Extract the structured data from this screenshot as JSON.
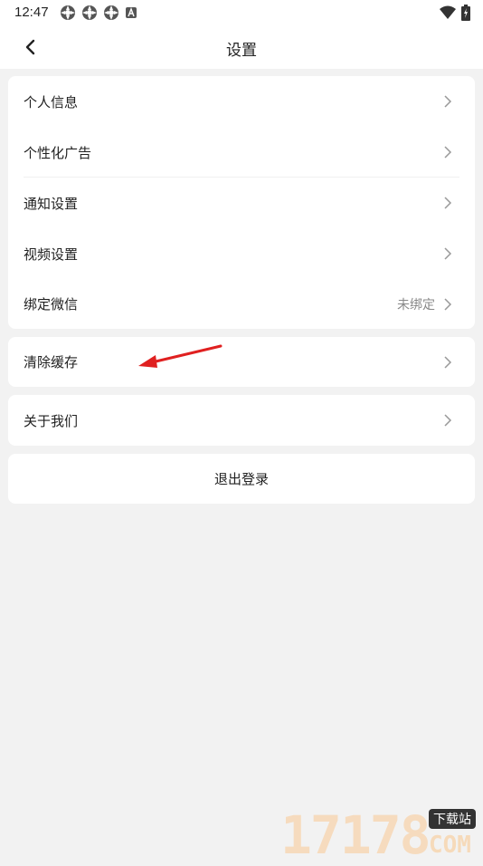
{
  "status_bar": {
    "time": "12:47",
    "notification_icons": [
      "app-icon",
      "app-icon",
      "app-icon",
      "a-box-icon"
    ],
    "right_icons": [
      "wifi-icon",
      "battery-charging-icon"
    ]
  },
  "header": {
    "back_icon": "chevron-left-icon",
    "title": "设置"
  },
  "groups": [
    {
      "items": [
        {
          "label": "个人信息",
          "value": ""
        },
        {
          "label": "个性化广告",
          "value": ""
        },
        {
          "label": "通知设置",
          "value": ""
        },
        {
          "label": "视频设置",
          "value": ""
        },
        {
          "label": "绑定微信",
          "value": "未绑定"
        }
      ]
    },
    {
      "items": [
        {
          "label": "清除缓存",
          "value": ""
        }
      ]
    },
    {
      "items": [
        {
          "label": "关于我们",
          "value": ""
        }
      ]
    }
  ],
  "logout_label": "退出登录",
  "annotation": {
    "type": "red-arrow",
    "color": "#e02020"
  },
  "watermark": {
    "number": "17178",
    "tag": "下载站",
    "domain": "COM"
  },
  "colors": {
    "background": "#f2f2f2",
    "card": "#ffffff",
    "text": "#222222",
    "secondary_text": "#888888"
  }
}
